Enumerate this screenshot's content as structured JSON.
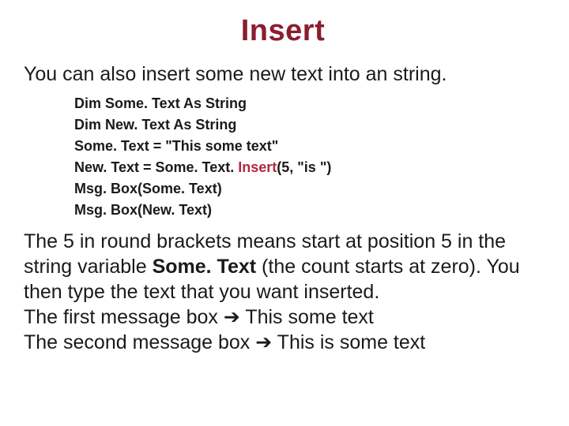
{
  "title": "Insert",
  "intro": "You can also insert some new text into an string.",
  "code": {
    "l1": "Dim Some. Text As String",
    "l2": "Dim New. Text As String",
    "l3": "Some. Text = \"This some text\"",
    "l4_pre": "New. Text = Some. Text. ",
    "l4_kw": "Insert",
    "l4_post": "(5, \"is \")",
    "l5": "Msg. Box(Some. Text)",
    "l6": "Msg. Box(New. Text)"
  },
  "explain": {
    "p1_a": "The 5 in round brackets means start at position 5 in the string variable ",
    "p1_bold": "Some. Text",
    "p1_b": " (the count starts at zero). You then type the text that you want inserted.",
    "p2": "The first message box ➔ This some text",
    "p3": "The second message box ➔ This is some text"
  },
  "colors": {
    "accent": "#8b1d2e"
  }
}
